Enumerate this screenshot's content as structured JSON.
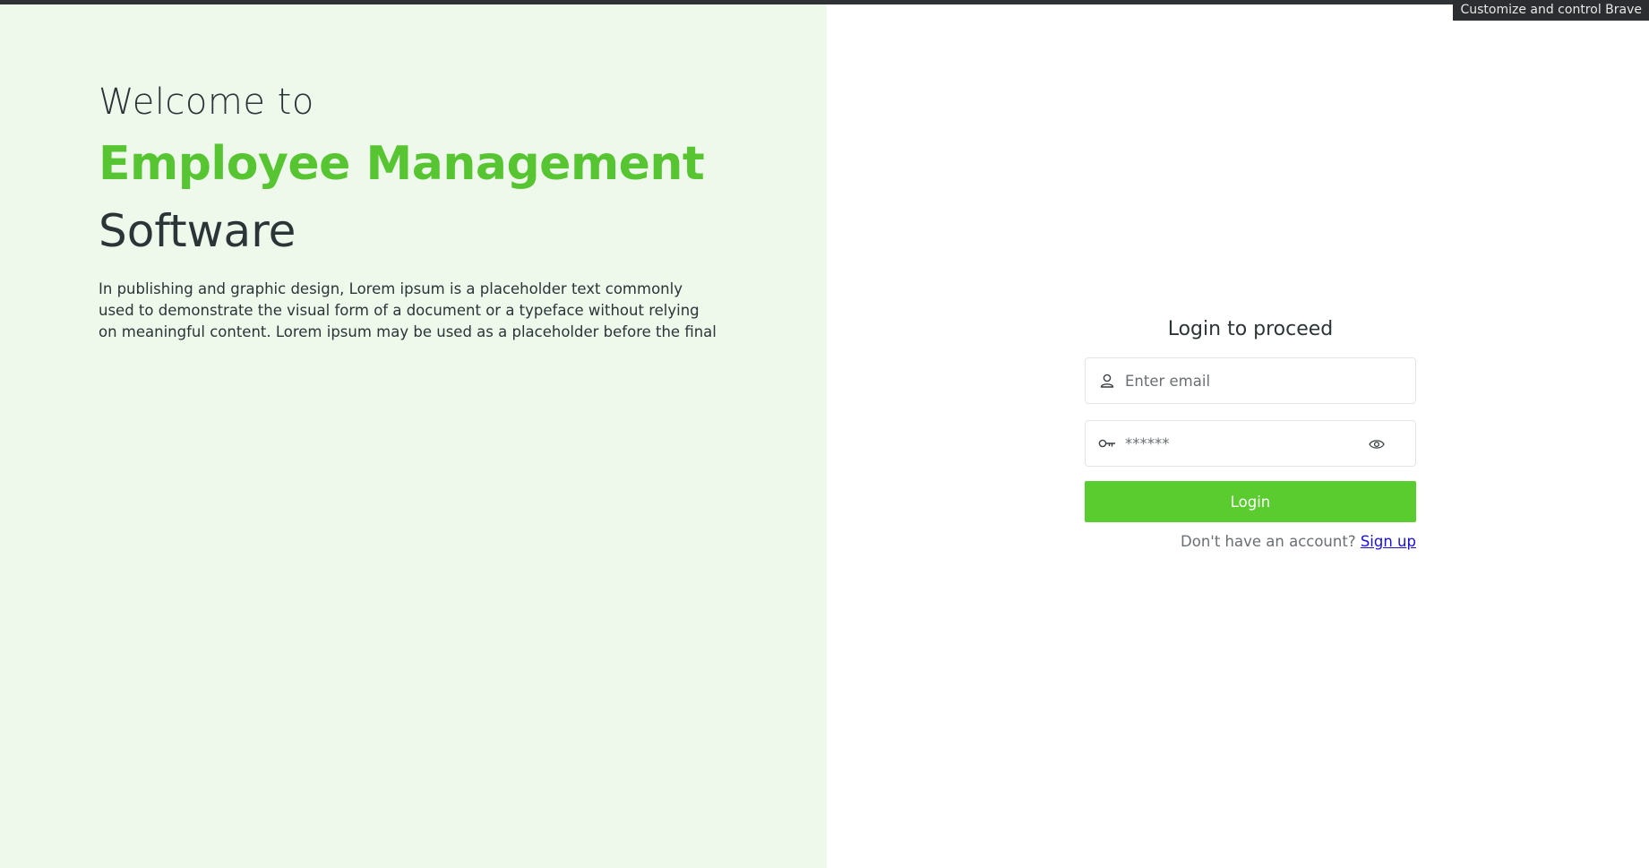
{
  "browser": {
    "tooltip": "Customize and control Brave"
  },
  "hero": {
    "welcome": "Welcome to",
    "brand": "Employee Management",
    "subtitle": "Software",
    "description": "In publishing and graphic design, Lorem ipsum is a placeholder text commonly used to demonstrate the visual form of a document or a typeface without relying on meaningful content. Lorem ipsum may be used as a placeholder before the final"
  },
  "login": {
    "title": "Login to proceed",
    "email_placeholder": "Enter email",
    "password_value": "******",
    "button_label": "Login",
    "signup_prompt": "Don't have an account?",
    "signup_link": "Sign up"
  },
  "colors": {
    "accent": "#5bcc2f",
    "left_panel_bg": "#eef9ec",
    "text_dark": "#2b3437",
    "link": "#1a10d8"
  },
  "icons": {
    "email": "user-icon",
    "password": "key-icon",
    "toggle": "eye-icon"
  }
}
